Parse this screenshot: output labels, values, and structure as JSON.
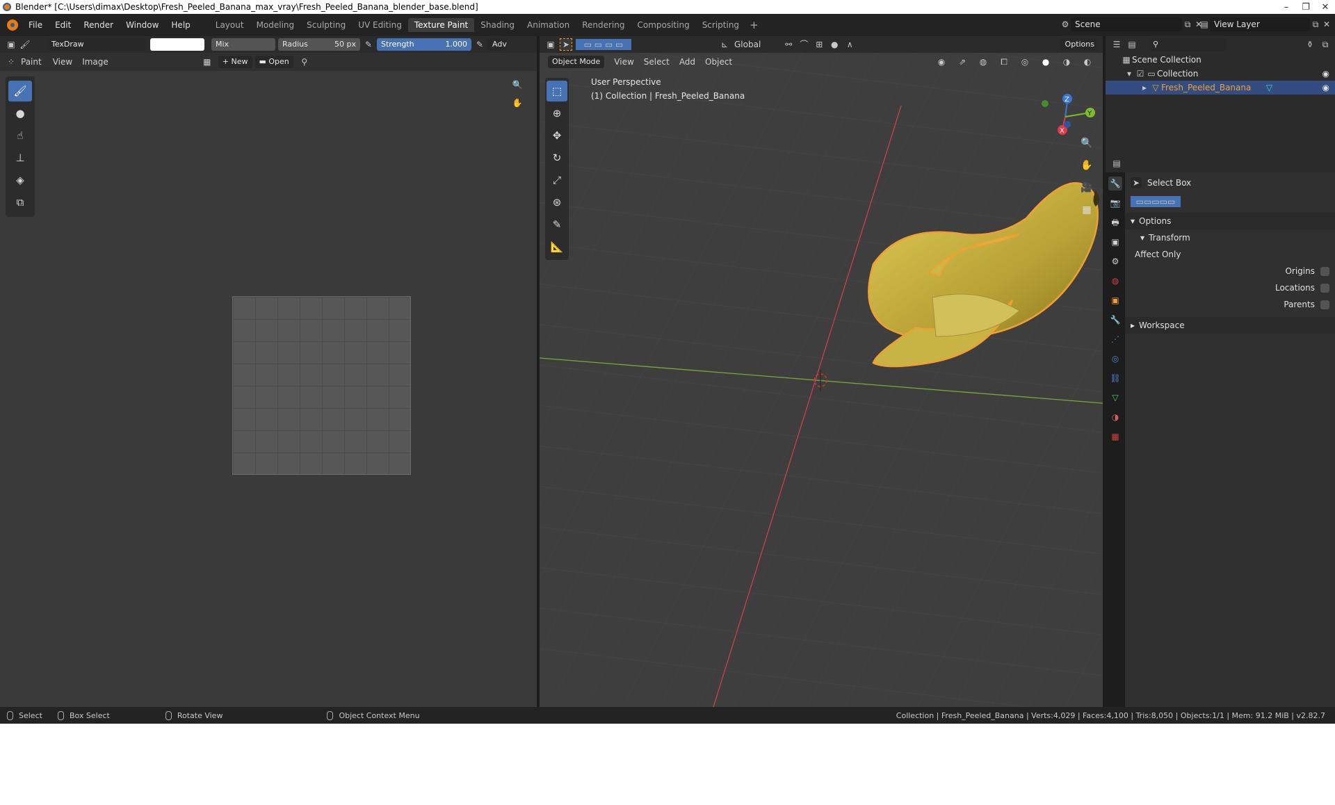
{
  "window": {
    "title": "Blender* [C:\\Users\\dimax\\Desktop\\Fresh_Peeled_Banana_max_vray\\Fresh_Peeled_Banana_blender_base.blend]"
  },
  "menu": [
    "File",
    "Edit",
    "Render",
    "Window",
    "Help"
  ],
  "workspaces": [
    "Layout",
    "Modeling",
    "Sculpting",
    "UV Editing",
    "Texture Paint",
    "Shading",
    "Animation",
    "Rendering",
    "Compositing",
    "Scripting"
  ],
  "active_workspace": "Texture Paint",
  "scene": {
    "name": "Scene",
    "view_layer": "View Layer"
  },
  "brush": {
    "name": "TexDraw",
    "blend": "Mix",
    "radius_label": "Radius",
    "radius_value": "50 px",
    "strength_label": "Strength",
    "strength_value": "1.000",
    "adv": "Adv"
  },
  "image_editor": {
    "mode": "Paint",
    "view": "View",
    "image": "Image",
    "new": "New",
    "open": "Open"
  },
  "viewport": {
    "mode": "Object Mode",
    "view": "View",
    "select": "Select",
    "add": "Add",
    "object": "Object",
    "orientation": "Global",
    "options": "Options",
    "perspective": "User Perspective",
    "collection_info": "(1) Collection | Fresh_Peeled_Banana"
  },
  "outliner": {
    "root": "Scene Collection",
    "collection": "Collection",
    "object": "Fresh_Peeled_Banana"
  },
  "properties": {
    "tool": "Select Box",
    "options": "Options",
    "transform": "Transform",
    "affect_only": "Affect Only",
    "origins": "Origins",
    "locations": "Locations",
    "parents": "Parents",
    "workspace": "Workspace"
  },
  "status": {
    "select": "Select",
    "box_select": "Box Select",
    "rotate_view": "Rotate View",
    "context_menu": "Object Context Menu",
    "stats": "Collection | Fresh_Peeled_Banana | Verts:4,029 | Faces:4,100 | Tris:8,050 | Objects:1/1 | Mem: 91.2 MiB | v2.82.7"
  },
  "colors": {
    "accent": "#4772b3",
    "selection_orange": "#f0a030",
    "banana": "#c9b23a",
    "x_axis": "#c84050",
    "y_axis": "#7aa83a"
  }
}
